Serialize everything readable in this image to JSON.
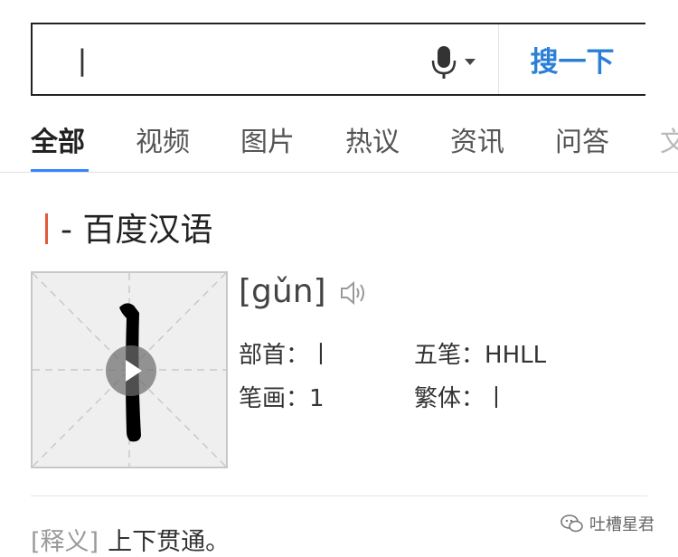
{
  "search": {
    "value": "丨",
    "button_label": "搜一下",
    "mic_icon": "microphone-icon"
  },
  "tabs": [
    {
      "label": "全部",
      "active": true
    },
    {
      "label": "视频",
      "active": false
    },
    {
      "label": "图片",
      "active": false
    },
    {
      "label": "热议",
      "active": false
    },
    {
      "label": "资讯",
      "active": false
    },
    {
      "label": "问答",
      "active": false
    },
    {
      "label": "文",
      "active": false
    }
  ],
  "result": {
    "title_char": "丨",
    "title_text": "- 百度汉语",
    "pinyin": "[gǔn]",
    "details": {
      "radical_label": "部首：",
      "radical_value": "丨",
      "wubi_label": "五笔：",
      "wubi_value": "HHLL",
      "strokes_label": "笔画：",
      "strokes_value": "1",
      "traditional_label": "繁体：",
      "traditional_value": "丨"
    },
    "definition_tag": "[释义]",
    "definition_text": "上下贯通。"
  },
  "watermark": {
    "text": "吐槽星君"
  },
  "colors": {
    "accent_blue": "#3385ff",
    "search_button_text": "#2b7fd6",
    "title_marker": "#e05a38"
  }
}
